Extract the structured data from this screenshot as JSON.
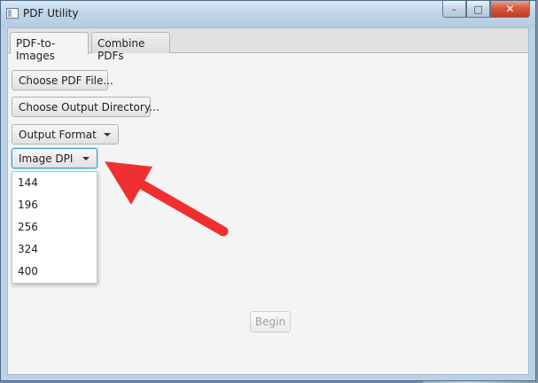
{
  "window": {
    "title": "PDF Utility",
    "controls": {
      "minimize": "–",
      "maximize": "□",
      "close": "✕"
    }
  },
  "tabs": [
    {
      "label": "PDF-to-Images",
      "active": true
    },
    {
      "label": "Combine PDFs",
      "active": false
    }
  ],
  "content": {
    "choose_pdf_label": "Choose PDF File...",
    "choose_dir_label": "Choose Output Directory...",
    "output_format_label": "Output Format",
    "image_dpi_label": "Image DPI",
    "dpi_options": [
      "144",
      "196",
      "256",
      "324",
      "400"
    ],
    "begin_label": "Begin"
  },
  "annotation": {
    "arrow_color": "#f03030"
  },
  "colors": {
    "focus_accent": "#3c9fd3",
    "title_bar": "#c1d5ea",
    "close_button": "#d6583f"
  }
}
